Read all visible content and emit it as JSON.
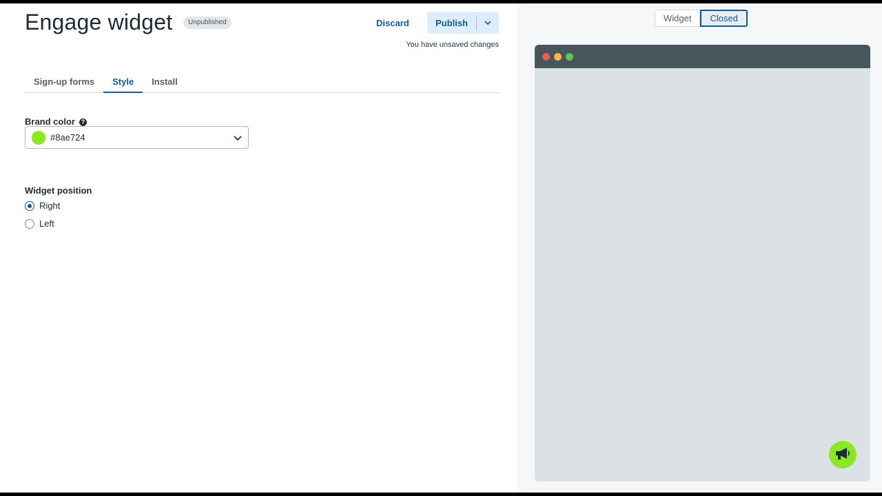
{
  "header": {
    "title": "Engage widget",
    "status_badge": "Unpublished",
    "discard_label": "Discard",
    "publish_label": "Publish",
    "unsaved_text": "You have unsaved changes"
  },
  "tabs": [
    {
      "label": "Sign-up forms",
      "active": false
    },
    {
      "label": "Style",
      "active": true
    },
    {
      "label": "Install",
      "active": false
    }
  ],
  "brand_color": {
    "label": "Brand color",
    "help_icon": "question-circle-icon",
    "value": "#8ae724",
    "swatch_color": "#8ae724"
  },
  "widget_position": {
    "label": "Widget position",
    "options": [
      {
        "label": "Right",
        "checked": true
      },
      {
        "label": "Left",
        "checked": false
      }
    ]
  },
  "preview": {
    "toggle": [
      {
        "label": "Widget",
        "active": false
      },
      {
        "label": "Closed",
        "active": true
      }
    ],
    "window_dots": [
      "#ee5b54",
      "#f5b64a",
      "#5dc74c"
    ],
    "launcher_color": "#8ae724",
    "launcher_icon": "megaphone-icon"
  },
  "colors": {
    "accent": "#0f5b91",
    "publish_bg": "#ddeefa"
  }
}
